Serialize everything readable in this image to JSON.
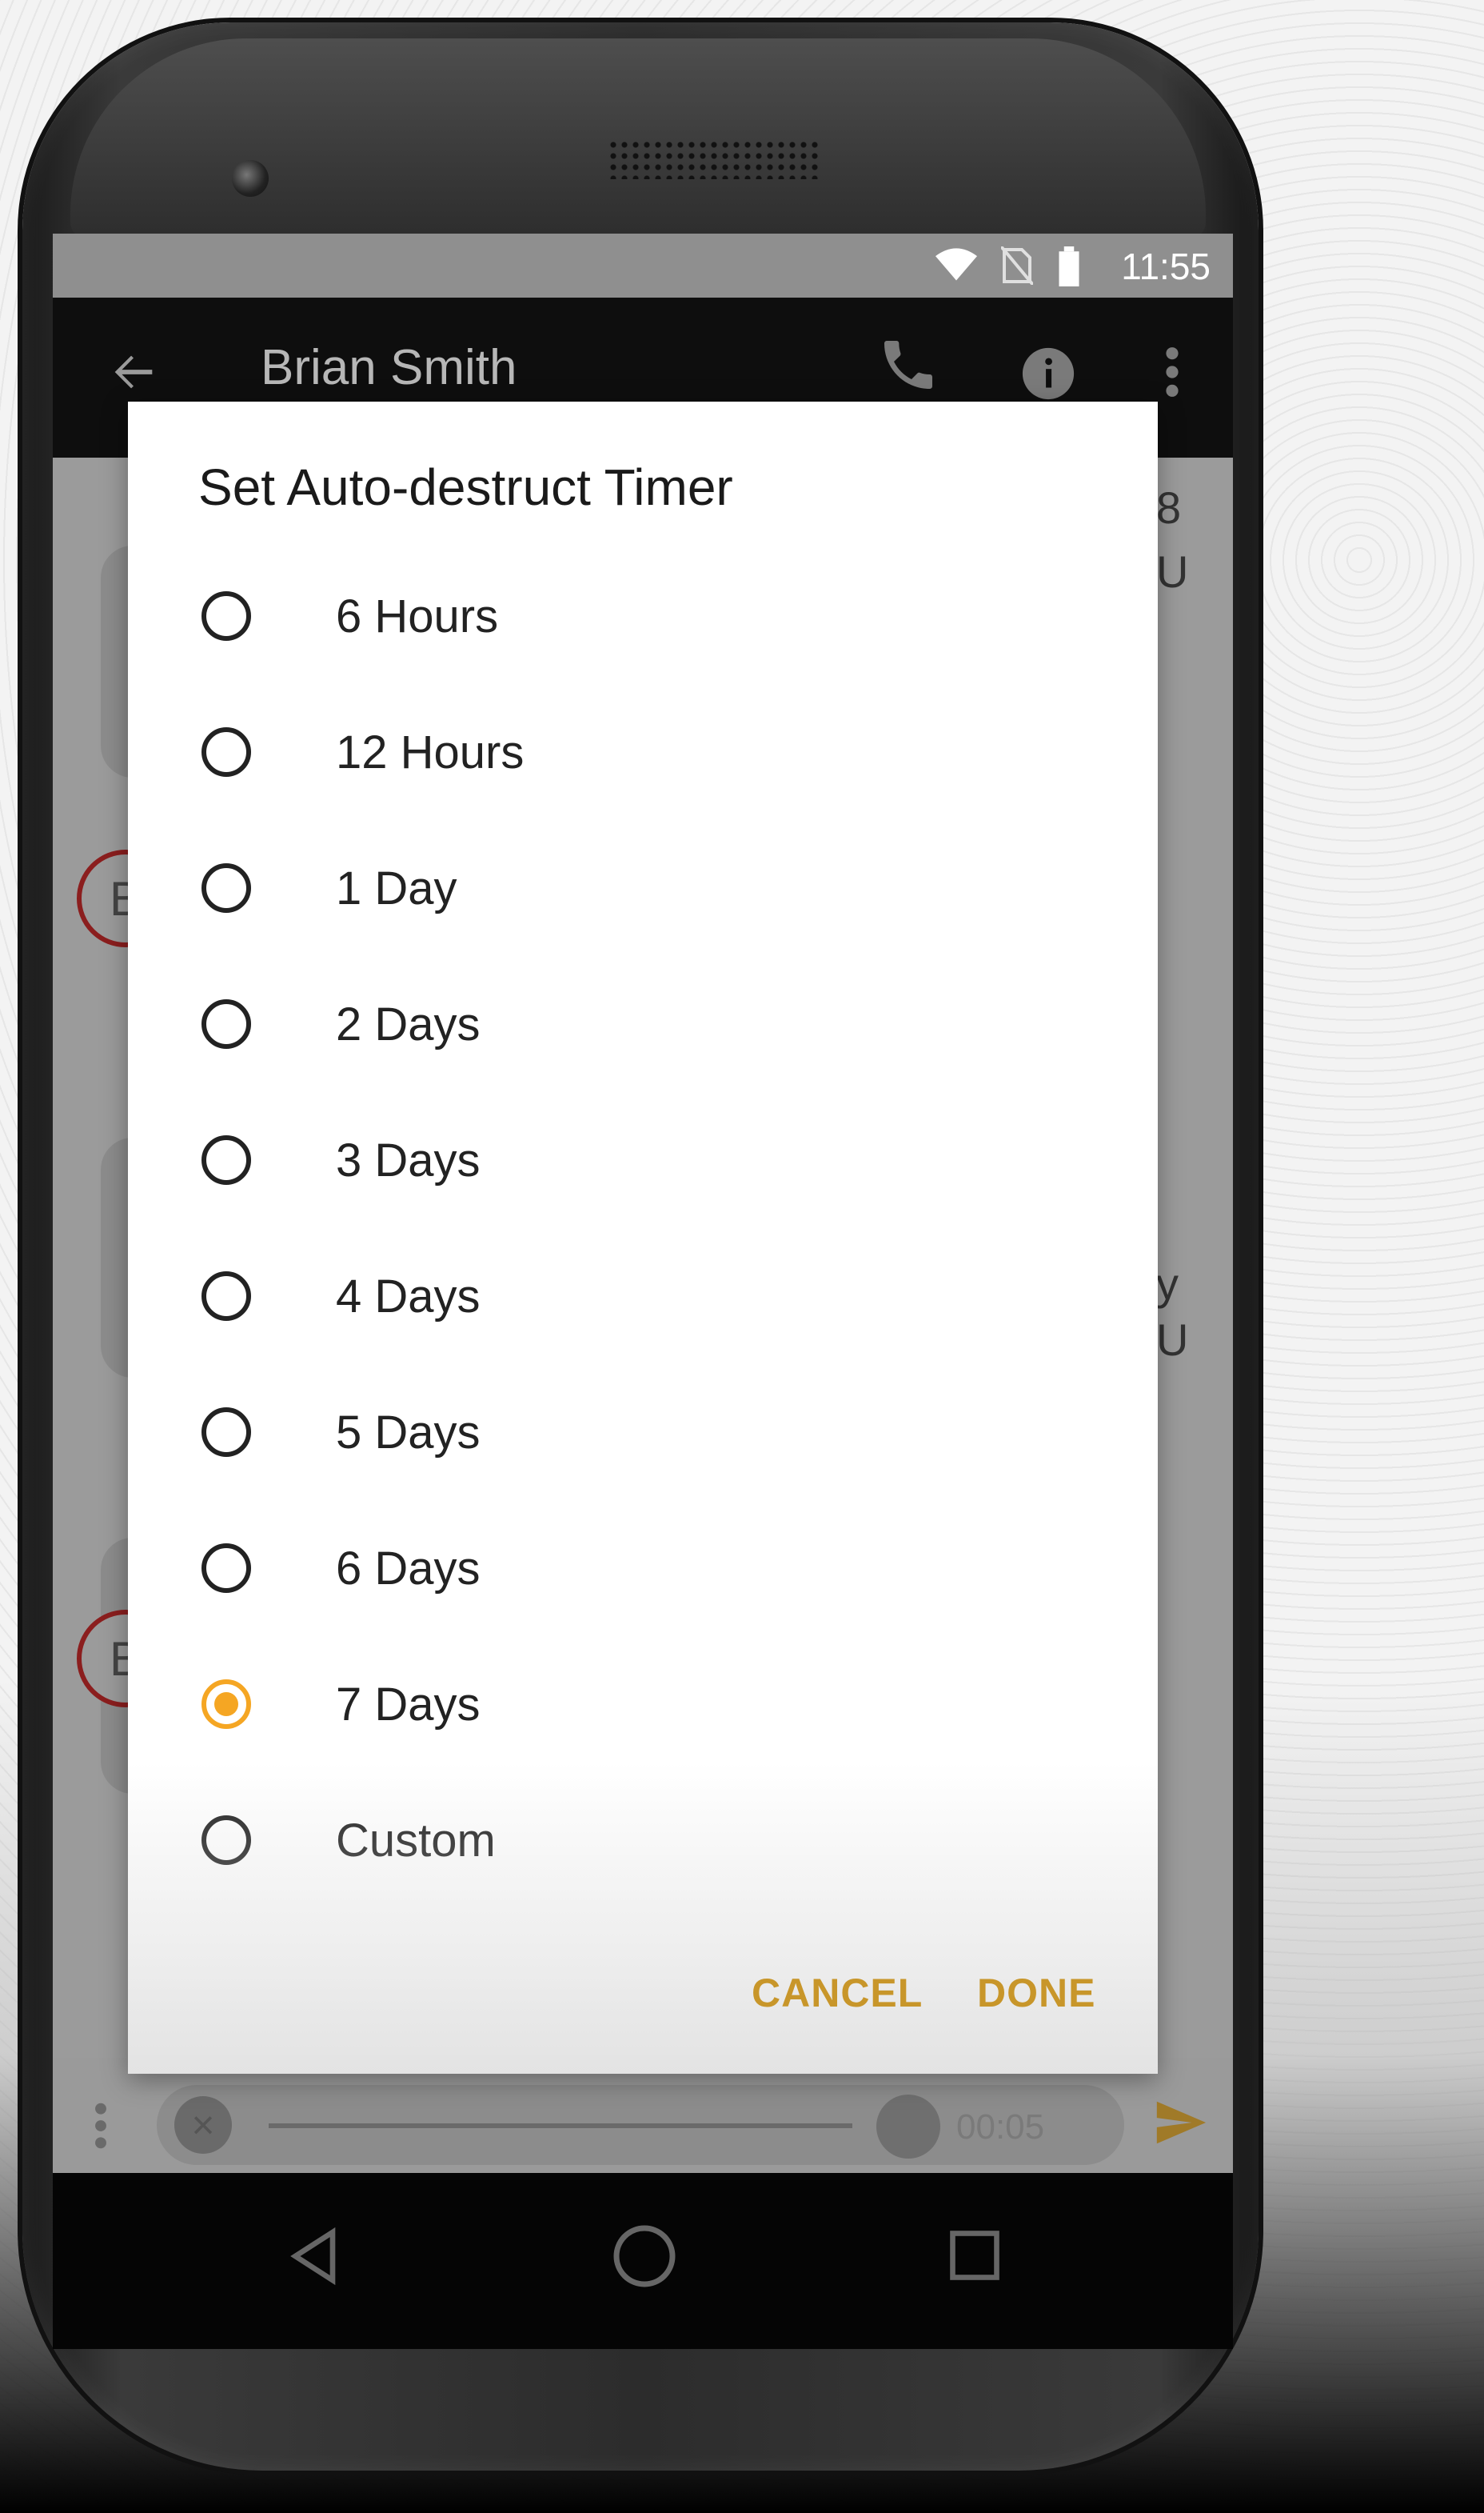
{
  "status_bar": {
    "time": "11:55"
  },
  "app_bar": {
    "title": "Brian Smith"
  },
  "dialog": {
    "title": "Set Auto-destruct Timer",
    "selected": "7 Days",
    "options": [
      {
        "label": "6 Hours",
        "checked": false
      },
      {
        "label": "12 Hours",
        "checked": false
      },
      {
        "label": "1 Day",
        "checked": false
      },
      {
        "label": "2 Days",
        "checked": false
      },
      {
        "label": "3 Days",
        "checked": false
      },
      {
        "label": "4 Days",
        "checked": false
      },
      {
        "label": "5 Days",
        "checked": false
      },
      {
        "label": "6 Days",
        "checked": false
      },
      {
        "label": "7 Days",
        "checked": true
      },
      {
        "label": "Custom",
        "checked": false
      }
    ],
    "cancel_label": "CANCEL",
    "done_label": "DONE"
  },
  "background_chat": {
    "avatar_letter": "B",
    "peek_text": [
      "8",
      "U",
      "y",
      "U"
    ]
  },
  "composer": {
    "time": "00:05"
  },
  "colors": {
    "accent": "#f5a623",
    "button_text": "#c8962a",
    "avatar_ring": "#8b1e1e"
  },
  "icons": {
    "status": [
      "wifi-icon",
      "no-sim-icon",
      "battery-icon"
    ],
    "app_bar": [
      "back-arrow-icon",
      "phone-icon",
      "info-icon",
      "more-vert-icon"
    ],
    "nav": [
      "nav-back-icon",
      "nav-home-icon",
      "nav-recents-icon"
    ],
    "composer": [
      "close-icon",
      "play-icon",
      "send-icon"
    ]
  }
}
